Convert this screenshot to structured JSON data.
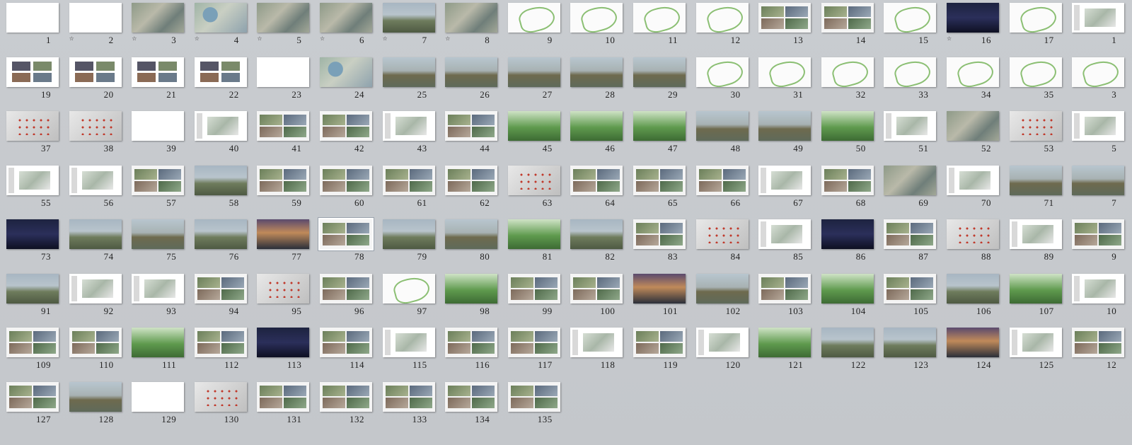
{
  "window": {
    "view": "Slide Sorter",
    "selected_slide": 78
  },
  "slides": [
    {
      "n": "1",
      "t": "blank"
    },
    {
      "n": "2",
      "t": "blank"
    },
    {
      "n": "3",
      "t": "aerial"
    },
    {
      "n": "4",
      "t": "map"
    },
    {
      "n": "5",
      "t": "aerial"
    },
    {
      "n": "6",
      "t": "aerial"
    },
    {
      "n": "7",
      "t": "photo"
    },
    {
      "n": "8",
      "t": "aerial"
    },
    {
      "n": "9",
      "t": "diagram"
    },
    {
      "n": "10",
      "t": "diagram"
    },
    {
      "n": "11",
      "t": "diagram"
    },
    {
      "n": "12",
      "t": "diagram"
    },
    {
      "n": "13",
      "t": "collage"
    },
    {
      "n": "14",
      "t": "collage"
    },
    {
      "n": "15",
      "t": "diagram"
    },
    {
      "n": "16",
      "t": "night"
    },
    {
      "n": "17",
      "t": "diagram"
    },
    {
      "n": "1",
      "t": "layout"
    },
    {
      "n": "19",
      "t": "grid4"
    },
    {
      "n": "20",
      "t": "grid4"
    },
    {
      "n": "21",
      "t": "grid4"
    },
    {
      "n": "22",
      "t": "grid4"
    },
    {
      "n": "23",
      "t": "blank"
    },
    {
      "n": "24",
      "t": "map"
    },
    {
      "n": "25",
      "t": "river"
    },
    {
      "n": "26",
      "t": "river"
    },
    {
      "n": "27",
      "t": "river"
    },
    {
      "n": "28",
      "t": "river"
    },
    {
      "n": "29",
      "t": "river"
    },
    {
      "n": "30",
      "t": "diagram"
    },
    {
      "n": "31",
      "t": "diagram"
    },
    {
      "n": "32",
      "t": "diagram"
    },
    {
      "n": "33",
      "t": "diagram"
    },
    {
      "n": "34",
      "t": "diagram"
    },
    {
      "n": "35",
      "t": "diagram"
    },
    {
      "n": "3",
      "t": "diagram"
    },
    {
      "n": "37",
      "t": "redmap"
    },
    {
      "n": "38",
      "t": "redmap"
    },
    {
      "n": "39",
      "t": "blank"
    },
    {
      "n": "40",
      "t": "layout"
    },
    {
      "n": "41",
      "t": "collage"
    },
    {
      "n": "42",
      "t": "collage"
    },
    {
      "n": "43",
      "t": "layout"
    },
    {
      "n": "44",
      "t": "collage"
    },
    {
      "n": "45",
      "t": "green"
    },
    {
      "n": "46",
      "t": "green"
    },
    {
      "n": "47",
      "t": "green"
    },
    {
      "n": "48",
      "t": "river"
    },
    {
      "n": "49",
      "t": "river"
    },
    {
      "n": "50",
      "t": "green"
    },
    {
      "n": "51",
      "t": "layout"
    },
    {
      "n": "52",
      "t": "aerial"
    },
    {
      "n": "53",
      "t": "redmap"
    },
    {
      "n": "5",
      "t": "layout"
    },
    {
      "n": "55",
      "t": "layout"
    },
    {
      "n": "56",
      "t": "layout"
    },
    {
      "n": "57",
      "t": "collage"
    },
    {
      "n": "58",
      "t": "photo"
    },
    {
      "n": "59",
      "t": "collage"
    },
    {
      "n": "60",
      "t": "collage"
    },
    {
      "n": "61",
      "t": "collage"
    },
    {
      "n": "62",
      "t": "collage"
    },
    {
      "n": "63",
      "t": "redmap"
    },
    {
      "n": "64",
      "t": "collage"
    },
    {
      "n": "65",
      "t": "collage"
    },
    {
      "n": "66",
      "t": "collage"
    },
    {
      "n": "67",
      "t": "layout"
    },
    {
      "n": "68",
      "t": "collage"
    },
    {
      "n": "69",
      "t": "aerial"
    },
    {
      "n": "70",
      "t": "layout"
    },
    {
      "n": "71",
      "t": "river"
    },
    {
      "n": "7",
      "t": "river"
    },
    {
      "n": "73",
      "t": "night"
    },
    {
      "n": "74",
      "t": "photo"
    },
    {
      "n": "75",
      "t": "river"
    },
    {
      "n": "76",
      "t": "photo"
    },
    {
      "n": "77",
      "t": "sunset"
    },
    {
      "n": "78",
      "t": "collage"
    },
    {
      "n": "79",
      "t": "photo"
    },
    {
      "n": "80",
      "t": "river"
    },
    {
      "n": "81",
      "t": "green"
    },
    {
      "n": "82",
      "t": "photo"
    },
    {
      "n": "83",
      "t": "collage"
    },
    {
      "n": "84",
      "t": "redmap"
    },
    {
      "n": "85",
      "t": "layout"
    },
    {
      "n": "86",
      "t": "night"
    },
    {
      "n": "87",
      "t": "collage"
    },
    {
      "n": "88",
      "t": "redmap"
    },
    {
      "n": "89",
      "t": "layout"
    },
    {
      "n": "9",
      "t": "collage"
    },
    {
      "n": "91",
      "t": "photo"
    },
    {
      "n": "92",
      "t": "layout"
    },
    {
      "n": "93",
      "t": "layout"
    },
    {
      "n": "94",
      "t": "collage"
    },
    {
      "n": "95",
      "t": "redmap"
    },
    {
      "n": "96",
      "t": "collage"
    },
    {
      "n": "97",
      "t": "diagram"
    },
    {
      "n": "98",
      "t": "green"
    },
    {
      "n": "99",
      "t": "collage"
    },
    {
      "n": "100",
      "t": "collage"
    },
    {
      "n": "101",
      "t": "sunset"
    },
    {
      "n": "102",
      "t": "river"
    },
    {
      "n": "103",
      "t": "collage"
    },
    {
      "n": "104",
      "t": "green"
    },
    {
      "n": "105",
      "t": "collage"
    },
    {
      "n": "106",
      "t": "photo"
    },
    {
      "n": "107",
      "t": "green"
    },
    {
      "n": "10",
      "t": "layout"
    },
    {
      "n": "109",
      "t": "collage"
    },
    {
      "n": "110",
      "t": "collage"
    },
    {
      "n": "111",
      "t": "green"
    },
    {
      "n": "112",
      "t": "collage"
    },
    {
      "n": "113",
      "t": "night"
    },
    {
      "n": "114",
      "t": "collage"
    },
    {
      "n": "115",
      "t": "layout"
    },
    {
      "n": "116",
      "t": "collage"
    },
    {
      "n": "117",
      "t": "collage"
    },
    {
      "n": "118",
      "t": "layout"
    },
    {
      "n": "119",
      "t": "collage"
    },
    {
      "n": "120",
      "t": "layout"
    },
    {
      "n": "121",
      "t": "green"
    },
    {
      "n": "122",
      "t": "photo"
    },
    {
      "n": "123",
      "t": "photo"
    },
    {
      "n": "124",
      "t": "sunset"
    },
    {
      "n": "125",
      "t": "layout"
    },
    {
      "n": "12",
      "t": "collage"
    },
    {
      "n": "127",
      "t": "collage"
    },
    {
      "n": "128",
      "t": "river"
    },
    {
      "n": "129",
      "t": "blank"
    },
    {
      "n": "130",
      "t": "redmap"
    },
    {
      "n": "131",
      "t": "collage"
    },
    {
      "n": "132",
      "t": "collage"
    },
    {
      "n": "133",
      "t": "collage"
    },
    {
      "n": "134",
      "t": "collage"
    },
    {
      "n": "135",
      "t": "collage"
    }
  ]
}
